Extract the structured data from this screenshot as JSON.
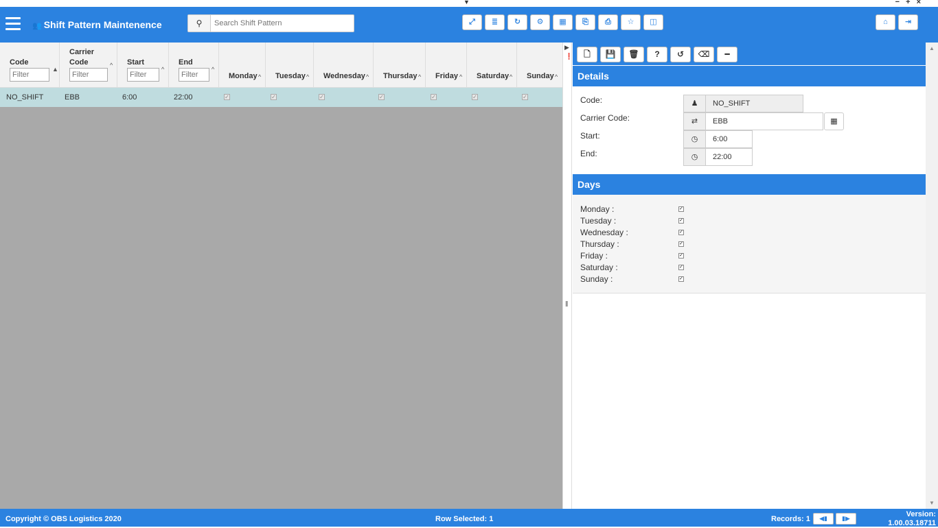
{
  "window": {
    "dropdown_glyph": "▼",
    "controls": "− + ×"
  },
  "header": {
    "title": "Shift Pattern Maintenence",
    "title_icon": "users-icon",
    "search_placeholder": "Search Shift Pattern",
    "toolbar_icons": [
      "expand-icon",
      "database-icon",
      "refresh-icon",
      "cogs-icon",
      "table-icon",
      "excel-export-icon",
      "pdf-export-icon",
      "star-icon",
      "columns-icon"
    ],
    "toolbar_glyphs": [
      "⤢",
      "≣",
      "↻",
      "⚙",
      "▦",
      "⎘",
      "⎙",
      "☆",
      "◫"
    ],
    "right_icons": [
      "home-icon",
      "logout-icon"
    ],
    "right_glyphs": [
      "⌂",
      "⇥"
    ]
  },
  "grid": {
    "columns": [
      {
        "label": "Code",
        "filter_placeholder": "Filter"
      },
      {
        "label": "Carrier\nCode",
        "filter_placeholder": "Filter"
      },
      {
        "label": "Start",
        "filter_placeholder": "Filter"
      },
      {
        "label": "End",
        "filter_placeholder": "Filter"
      },
      {
        "label": "Monday"
      },
      {
        "label": "Tuesday"
      },
      {
        "label": "Wednesday"
      },
      {
        "label": "Thursday"
      },
      {
        "label": "Friday"
      },
      {
        "label": "Saturday"
      },
      {
        "label": "Sunday"
      }
    ],
    "rows": [
      {
        "code": "NO_SHIFT",
        "carrier_code": "EBB",
        "start": "6:00",
        "end": "22:00",
        "monday": true,
        "tuesday": true,
        "wednesday": true,
        "thursday": true,
        "friday": true,
        "saturday": true,
        "sunday": true
      }
    ]
  },
  "detail_toolbar": {
    "icons": [
      "new-icon",
      "save-icon",
      "delete-icon",
      "help-icon",
      "undo-icon",
      "eraser-icon",
      "minus-icon"
    ],
    "glyphs": [
      "🗋",
      "💾",
      "🗑",
      "?",
      "↺",
      "⌫",
      "━"
    ]
  },
  "details": {
    "title": "Details",
    "code_label": "Code:",
    "code_value": "NO_SHIFT",
    "carrier_label": "Carrier Code:",
    "carrier_value": "EBB",
    "start_label": "Start:",
    "start_value": "6:00",
    "end_label": "End:",
    "end_value": "22:00"
  },
  "days": {
    "title": "Days",
    "items": [
      {
        "label": "Monday :",
        "checked": true
      },
      {
        "label": "Tuesday :",
        "checked": true
      },
      {
        "label": "Wednesday :",
        "checked": true
      },
      {
        "label": "Thursday :",
        "checked": true
      },
      {
        "label": "Friday :",
        "checked": true
      },
      {
        "label": "Saturday :",
        "checked": true
      },
      {
        "label": "Sunday :",
        "checked": true
      }
    ]
  },
  "footer": {
    "copyright": "Copyright © OBS Logistics 2020",
    "row_selected": "Row Selected: 1",
    "records": "Records: 1",
    "version_label": "Version:",
    "version_value": "1.00.03.18711"
  }
}
